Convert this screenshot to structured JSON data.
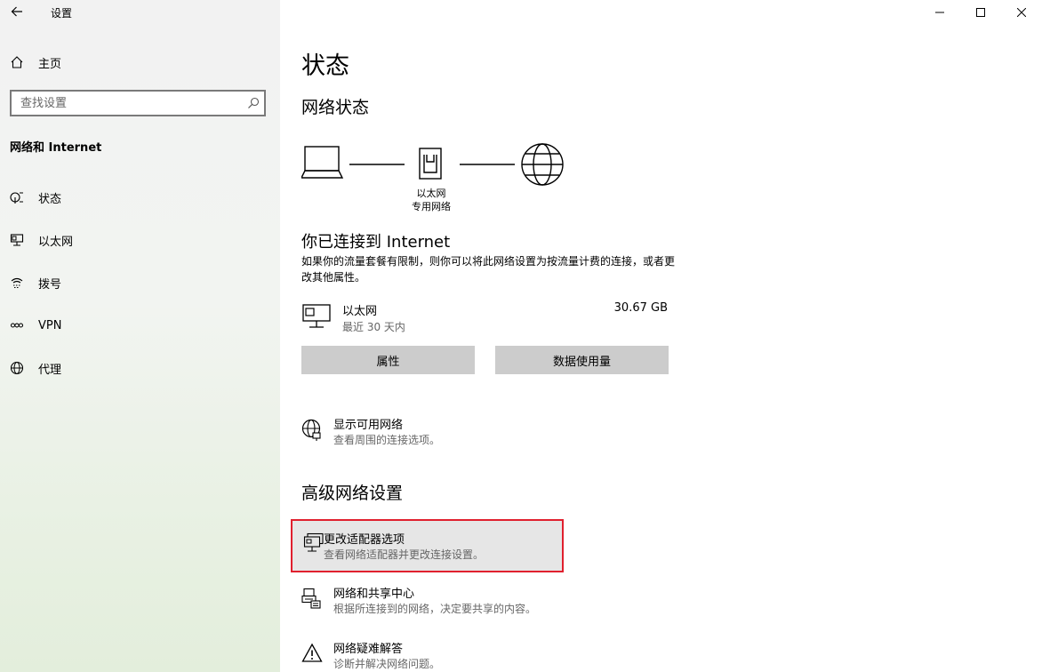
{
  "window": {
    "app_title": "设置",
    "back_icon": "back-arrow-icon"
  },
  "sidebar": {
    "home_label": "主页",
    "search_placeholder": "查找设置",
    "section_title": "网络和 Internet",
    "items": [
      {
        "label": "状态",
        "icon": "status-icon"
      },
      {
        "label": "以太网",
        "icon": "ethernet-icon"
      },
      {
        "label": "拨号",
        "icon": "dialup-icon"
      },
      {
        "label": "VPN",
        "icon": "vpn-icon"
      },
      {
        "label": "代理",
        "icon": "proxy-globe-icon"
      }
    ]
  },
  "main": {
    "page_title": "状态",
    "network_status_heading": "网络状态",
    "diagram": {
      "adapter_label_line1": "以太网",
      "adapter_label_line2": "专用网络"
    },
    "connected_title": "你已连接到 Internet",
    "connected_desc": "如果你的流量套餐有限制，则你可以将此网络设置为按流量计费的连接，或者更改其他属性。",
    "ethernet": {
      "name": "以太网",
      "usage_period": "最近 30 天内",
      "data_used": "30.67 GB"
    },
    "buttons": {
      "properties": "属性",
      "data_usage": "数据使用量"
    },
    "show_networks": {
      "title": "显示可用网络",
      "subtitle": "查看周围的连接选项。"
    },
    "advanced_heading": "高级网络设置",
    "advanced_items": [
      {
        "title": "更改适配器选项",
        "subtitle": "查看网络适配器并更改连接设置。"
      },
      {
        "title": "网络和共享中心",
        "subtitle": "根据所连接到的网络，决定要共享的内容。"
      },
      {
        "title": "网络疑难解答",
        "subtitle": "诊断并解决网络问题。"
      }
    ]
  }
}
